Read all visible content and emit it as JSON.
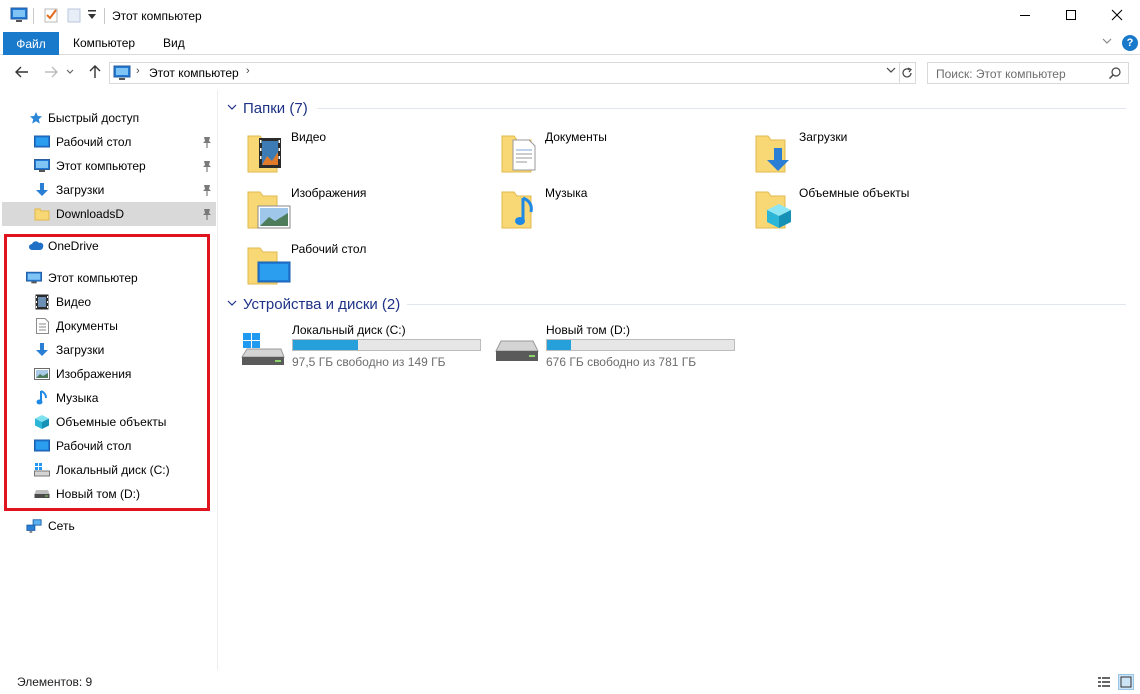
{
  "window": {
    "title": "Этот компьютер",
    "minimize_glyph": "—",
    "maximize_glyph": "☐",
    "close_glyph": "✕"
  },
  "ribbon": {
    "tabs": [
      "Файл",
      "Компьютер",
      "Вид"
    ],
    "help_glyph": "?"
  },
  "address": {
    "path": "Этот компьютер",
    "search_placeholder": "Поиск: Этот компьютер"
  },
  "nav": {
    "quick_access": {
      "label": "Быстрый доступ",
      "items": [
        {
          "label": "Рабочий стол",
          "icon": "desktop-icon",
          "pinned": true
        },
        {
          "label": "Этот компьютер",
          "icon": "computer-icon",
          "pinned": true
        },
        {
          "label": "Загрузки",
          "icon": "downloads-icon",
          "pinned": true
        },
        {
          "label": "DownloadsD",
          "icon": "folder-icon",
          "pinned": true,
          "selected": true
        }
      ]
    },
    "onedrive": {
      "label": "OneDrive"
    },
    "this_pc": {
      "label": "Этот компьютер",
      "items": [
        {
          "label": "Видео",
          "icon": "video-icon"
        },
        {
          "label": "Документы",
          "icon": "documents-icon"
        },
        {
          "label": "Загрузки",
          "icon": "downloads-icon"
        },
        {
          "label": "Изображения",
          "icon": "pictures-icon"
        },
        {
          "label": "Музыка",
          "icon": "music-icon"
        },
        {
          "label": "Объемные объекты",
          "icon": "3d-objects-icon"
        },
        {
          "label": "Рабочий стол",
          "icon": "desktop-icon"
        },
        {
          "label": "Локальный диск (C:)",
          "icon": "windows-drive-icon"
        },
        {
          "label": "Новый том (D:)",
          "icon": "drive-icon"
        }
      ]
    },
    "network": {
      "label": "Сеть"
    },
    "highlight_color": "#e0141e"
  },
  "content": {
    "folders_group": "Папки (7)",
    "folders": [
      {
        "label": "Видео",
        "icon": "video-folder-icon"
      },
      {
        "label": "Документы",
        "icon": "documents-folder-icon"
      },
      {
        "label": "Загрузки",
        "icon": "downloads-folder-icon"
      },
      {
        "label": "Изображения",
        "icon": "pictures-folder-icon"
      },
      {
        "label": "Музыка",
        "icon": "music-folder-icon"
      },
      {
        "label": "Объемные объекты",
        "icon": "3d-objects-folder-icon"
      },
      {
        "label": "Рабочий стол",
        "icon": "desktop-folder-icon"
      }
    ],
    "drives_group": "Устройства и диски (2)",
    "drives": [
      {
        "label": "Локальный диск (C:)",
        "free": "97,5 ГБ свободно из 149 ГБ",
        "used_fraction": 0.35,
        "icon": "windows-drive-icon"
      },
      {
        "label": "Новый том (D:)",
        "free": "676 ГБ свободно из 781 ГБ",
        "used_fraction": 0.13,
        "icon": "drive-icon"
      }
    ],
    "bar_color": "#26a0da"
  },
  "status": {
    "items_text": "Элементов: 9"
  }
}
